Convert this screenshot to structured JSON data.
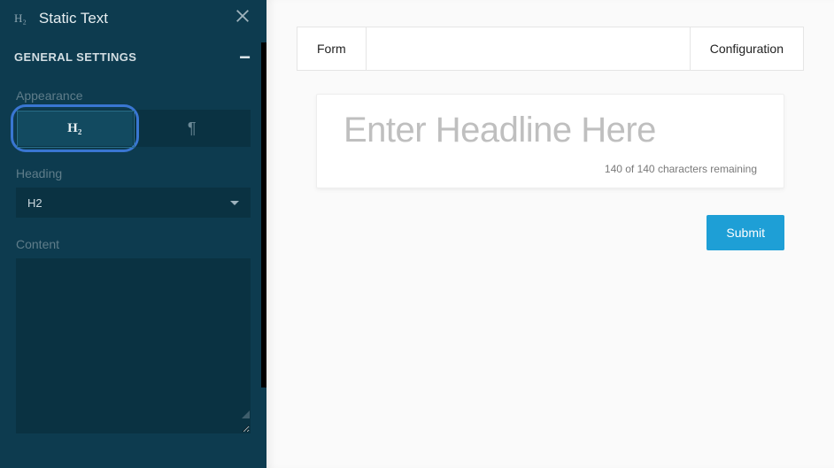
{
  "sidebar": {
    "icon_label": "H₂",
    "title": "Static Text",
    "section_label": "GENERAL SETTINGS",
    "appearance_label": "Appearance",
    "appearance_options": {
      "h2": "H₂",
      "paragraph": "¶"
    },
    "heading_label": "Heading",
    "heading_value": "H2",
    "content_label": "Content",
    "content_value": ""
  },
  "main": {
    "tabs": {
      "form": "Form",
      "config": "Configuration"
    },
    "headline_placeholder": "Enter Headline Here",
    "char_count": "140 of 140 characters remaining",
    "submit_label": "Submit"
  }
}
